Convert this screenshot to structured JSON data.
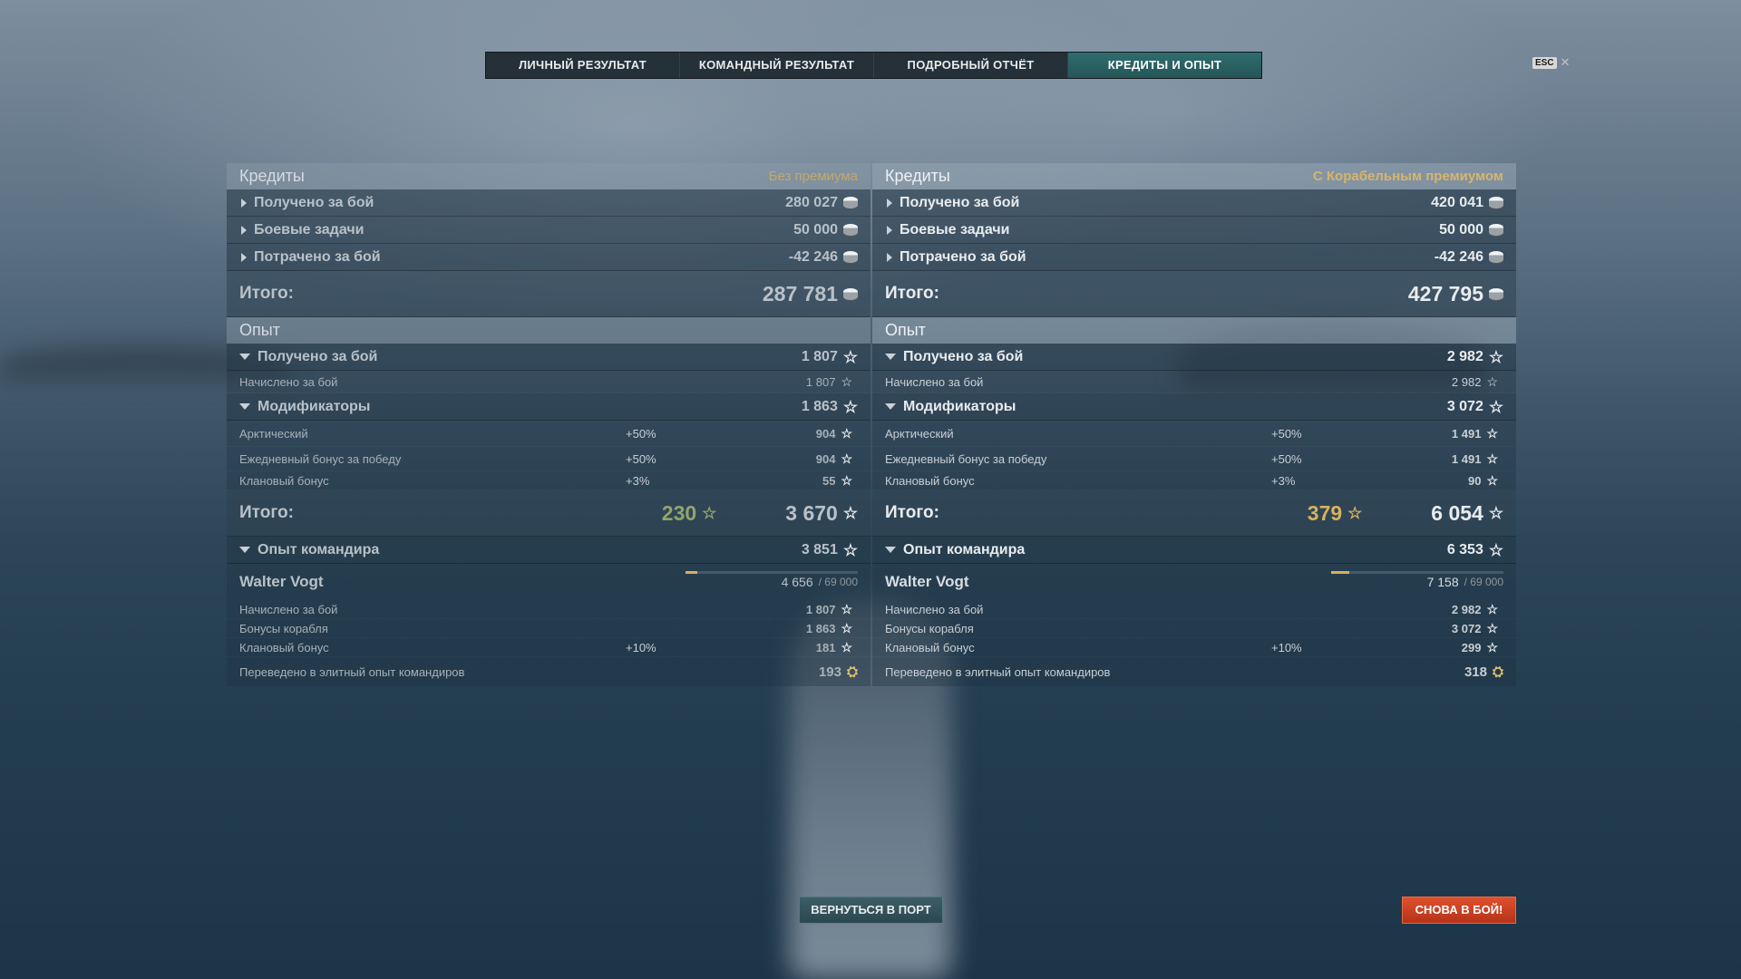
{
  "tabs": [
    "ЛИЧНЫЙ РЕЗУЛЬТАТ",
    "КОМАНДНЫЙ РЕЗУЛЬТАТ",
    "ПОДРОБНЫЙ ОТЧЁТ",
    "КРЕДИТЫ И ОПЫТ"
  ],
  "active_tab": "КРЕДИТЫ И ОПЫТ",
  "esc": {
    "key": "ESC",
    "close": "✕"
  },
  "left": {
    "credits_title": "Кредиты",
    "badge": "Без премиума",
    "credits": [
      {
        "label": "Получено за бой",
        "value": "280 027"
      },
      {
        "label": "Боевые задачи",
        "value": "50 000"
      },
      {
        "label": "Потрачено за бой",
        "value": "-42 246"
      }
    ],
    "credits_total_label": "Итого:",
    "credits_total": "287 781",
    "xp_title": "Опыт",
    "earned_label": "Получено за бой",
    "earned": "1 807",
    "earned_sub_label": "Начислено за бой",
    "earned_sub": "1 807",
    "mods_label": "Модификаторы",
    "mods": "1 863",
    "mod_rows": [
      {
        "label": "Арктический",
        "pct": "+50%",
        "value": "904"
      },
      {
        "label": "Ежедневный бонус за победу",
        "pct": "+50%",
        "value": "904"
      },
      {
        "label": "Клановый бонус",
        "pct": "+3%",
        "value": "55"
      }
    ],
    "xp_total_label": "Итого:",
    "xp_free": "230",
    "xp_total": "3 670",
    "cmd_label": "Опыт командира",
    "cmd_value": "3 851",
    "cmd_name": "Walter Vogt",
    "cmd_current": "4 656",
    "cmd_max": "/ 69 000",
    "cmd_progress": 0.067,
    "cmd_rows": [
      {
        "label": "Начислено за бой",
        "pct": "",
        "value": "1 807"
      },
      {
        "label": "Бонусы корабля",
        "pct": "",
        "value": "1 863"
      },
      {
        "label": "Клановый бонус",
        "pct": "+10%",
        "value": "181"
      }
    ],
    "elite_label": "Переведено в элитный опыт командиров",
    "elite_value": "193"
  },
  "right": {
    "credits_title": "Кредиты",
    "badge": "С Корабельным премиумом",
    "credits": [
      {
        "label": "Получено за бой",
        "value": "420 041"
      },
      {
        "label": "Боевые задачи",
        "value": "50 000"
      },
      {
        "label": "Потрачено за бой",
        "value": "-42 246"
      }
    ],
    "credits_total_label": "Итого:",
    "credits_total": "427 795",
    "xp_title": "Опыт",
    "earned_label": "Получено за бой",
    "earned": "2 982",
    "earned_sub_label": "Начислено за бой",
    "earned_sub": "2 982",
    "mods_label": "Модификаторы",
    "mods": "3 072",
    "mod_rows": [
      {
        "label": "Арктический",
        "pct": "+50%",
        "value": "1 491"
      },
      {
        "label": "Ежедневный бонус за победу",
        "pct": "+50%",
        "value": "1 491"
      },
      {
        "label": "Клановый бонус",
        "pct": "+3%",
        "value": "90"
      }
    ],
    "xp_total_label": "Итого:",
    "xp_free": "379",
    "xp_total": "6 054",
    "cmd_label": "Опыт командира",
    "cmd_value": "6 353",
    "cmd_name": "Walter Vogt",
    "cmd_current": "7 158",
    "cmd_max": "/ 69 000",
    "cmd_progress": 0.104,
    "cmd_rows": [
      {
        "label": "Начислено за бой",
        "pct": "",
        "value": "2 982"
      },
      {
        "label": "Бонусы корабля",
        "pct": "",
        "value": "3 072"
      },
      {
        "label": "Клановый бонус",
        "pct": "+10%",
        "value": "299"
      }
    ],
    "elite_label": "Переведено в элитный опыт командиров",
    "elite_value": "318"
  },
  "buttons": {
    "port": "ВЕРНУТЬСЯ В ПОРТ",
    "battle": "СНОВА В БОЙ!"
  },
  "colors": {
    "accent": "#2f6d6e",
    "badge": "#d9b46a",
    "battle": "#d2421f"
  }
}
